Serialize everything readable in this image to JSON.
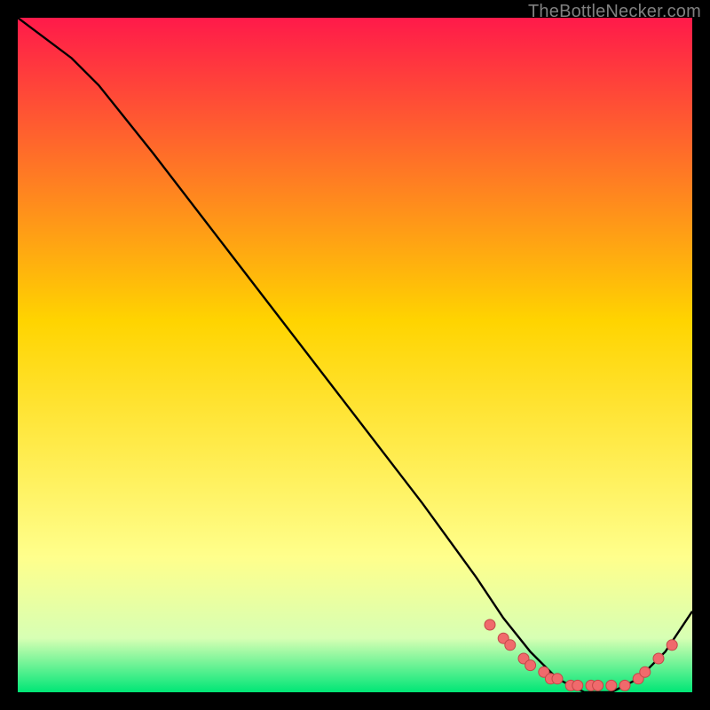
{
  "attribution": "TheBottleNecker.com",
  "colors": {
    "frame": "#000000",
    "gradient_top": "#ff1a4a",
    "gradient_mid": "#ffd400",
    "gradient_pal1": "#ffff8c",
    "gradient_pal2": "#d7ffb4",
    "gradient_bottom": "#00e676",
    "line": "#000000",
    "dot_fill": "#f06a6c",
    "dot_stroke": "#c24848"
  },
  "chart_data": {
    "type": "line",
    "title": "",
    "xlabel": "",
    "ylabel": "",
    "xlim": [
      0,
      100
    ],
    "ylim": [
      0,
      100
    ],
    "series": [
      {
        "name": "curve",
        "x": [
          0,
          8,
          12,
          20,
          30,
          40,
          50,
          60,
          68,
          72,
          76,
          80,
          84,
          88,
          92,
          96,
          100
        ],
        "y": [
          100,
          94,
          90,
          80,
          67,
          54,
          41,
          28,
          17,
          11,
          6,
          2,
          0,
          0,
          2,
          6,
          12
        ]
      }
    ],
    "dot_cluster": {
      "x": [
        70,
        72,
        73,
        75,
        76,
        78,
        79,
        80,
        82,
        83,
        85,
        86,
        88,
        90,
        92,
        93,
        95,
        97
      ],
      "y": [
        10,
        8,
        7,
        5,
        4,
        3,
        2,
        2,
        1,
        1,
        1,
        1,
        1,
        1,
        2,
        3,
        5,
        7
      ]
    }
  }
}
